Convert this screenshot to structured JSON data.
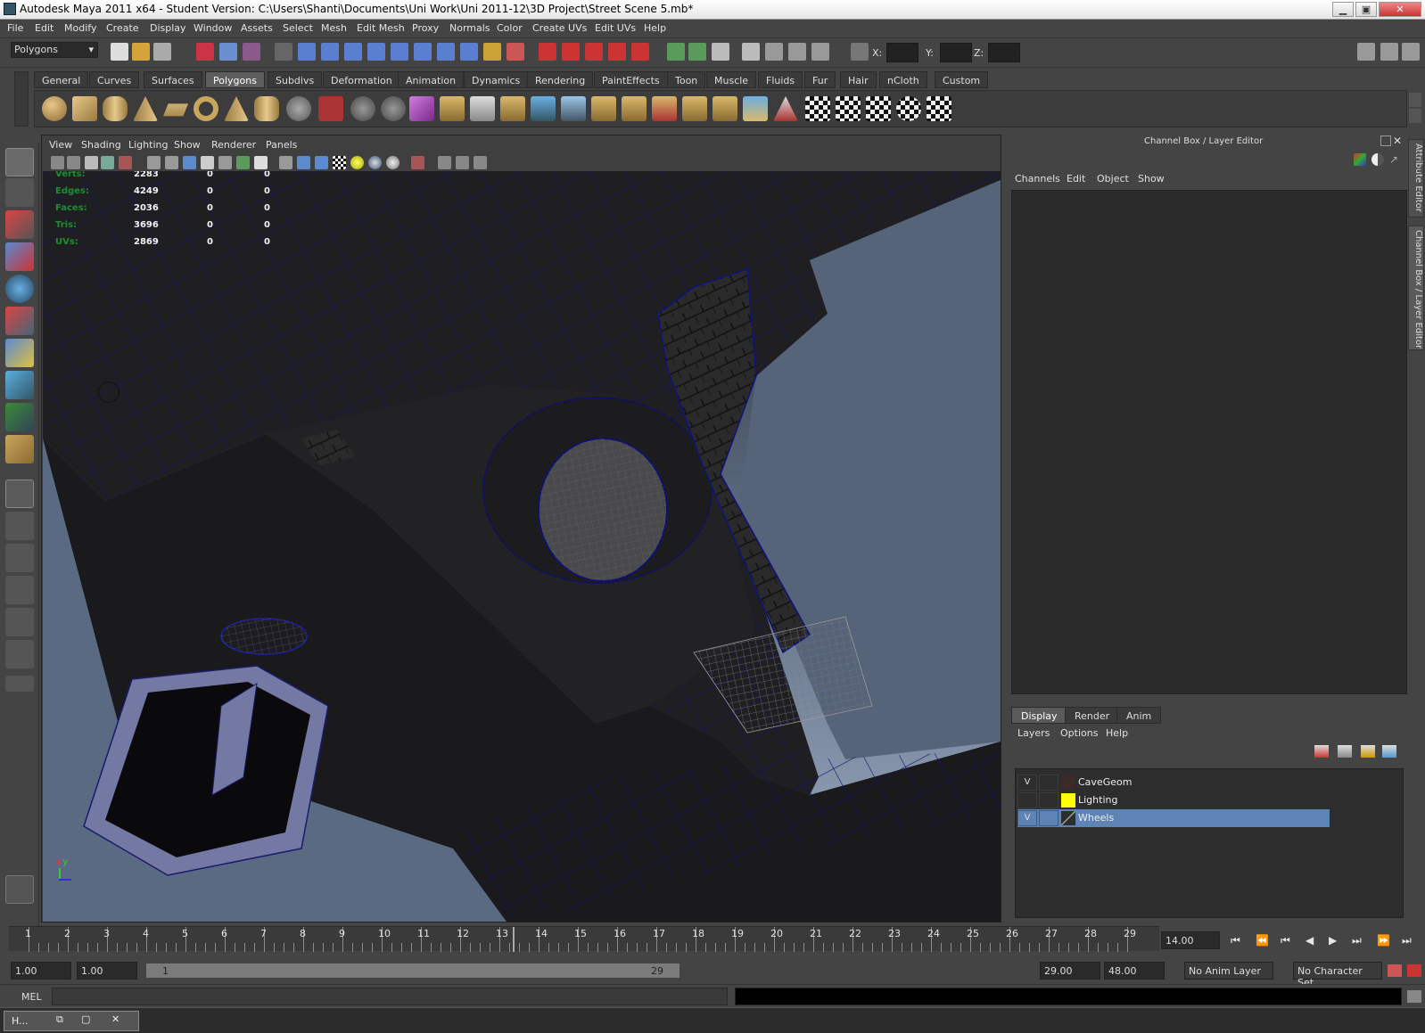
{
  "titlebar": {
    "title": "Autodesk Maya 2011 x64 - Student Version: C:\\Users\\Shanti\\Documents\\Uni Work\\Uni 2011-12\\3D Project\\Street Scene 5.mb*"
  },
  "menubar": [
    "File",
    "Edit",
    "Modify",
    "Create",
    "Display",
    "Window",
    "Assets",
    "Select",
    "Mesh",
    "Edit Mesh",
    "Proxy",
    "Normals",
    "Color",
    "Create UVs",
    "Edit UVs",
    "Help"
  ],
  "statusline": {
    "mode": "Polygons",
    "x_label": "X:",
    "y_label": "Y:",
    "z_label": "Z:"
  },
  "shelf_tabs": [
    "General",
    "Curves",
    "Surfaces",
    "Polygons",
    "Subdivs",
    "Deformation",
    "Animation",
    "Dynamics",
    "Rendering",
    "PaintEffects",
    "Toon",
    "Muscle",
    "Fluids",
    "Fur",
    "Hair",
    "nCloth",
    "Custom"
  ],
  "shelf_active": "Polygons",
  "viewport": {
    "menus": [
      "View",
      "Shading",
      "Lighting",
      "Show",
      "Renderer",
      "Panels"
    ],
    "hud": [
      {
        "label": "Verts:",
        "v1": "2283",
        "v2": "0",
        "v3": "0"
      },
      {
        "label": "Edges:",
        "v1": "4249",
        "v2": "0",
        "v3": "0"
      },
      {
        "label": "Faces:",
        "v1": "2036",
        "v2": "0",
        "v3": "0"
      },
      {
        "label": "Tris:",
        "v1": "3696",
        "v2": "0",
        "v3": "0"
      },
      {
        "label": "UVs:",
        "v1": "2869",
        "v2": "0",
        "v3": "0"
      }
    ],
    "axis_x": "x",
    "axis_y": "y"
  },
  "channel_box": {
    "title": "Channel Box / Layer Editor",
    "menus": [
      "Channels",
      "Edit",
      "Object",
      "Show"
    ]
  },
  "layer_editor": {
    "tabs": [
      "Display",
      "Render",
      "Anim"
    ],
    "active_tab": "Display",
    "menus": [
      "Layers",
      "Options",
      "Help"
    ],
    "layers": [
      {
        "visible": "V",
        "name": "CaveGeom",
        "color": "#3a2a2a",
        "selected": false
      },
      {
        "visible": "",
        "name": "Lighting",
        "color": "#ffff00",
        "selected": false
      },
      {
        "visible": "V",
        "name": "Wheels",
        "color": "#2d2d2d",
        "selected": true
      }
    ]
  },
  "side_tabs": [
    "Attribute Editor",
    "Channel Box / Layer Editor"
  ],
  "timeline": {
    "frames": [
      "1",
      "2",
      "3",
      "4",
      "5",
      "6",
      "7",
      "8",
      "9",
      "10",
      "11",
      "12",
      "13",
      "14",
      "15",
      "16",
      "17",
      "18",
      "19",
      "20",
      "21",
      "22",
      "23",
      "24",
      "25",
      "26",
      "27",
      "28",
      "29"
    ],
    "current_time": "14.00"
  },
  "range": {
    "start": "1.00",
    "playback_start": "1.00",
    "range_min": "1",
    "range_max": "29",
    "playback_end": "29.00",
    "end": "48.00",
    "anim_layer": "No Anim Layer",
    "char_set": "No Character Set"
  },
  "cmdline": {
    "label": "MEL"
  },
  "taskbar": {
    "item": "H..."
  },
  "colors": {
    "accent": "#5d84b5",
    "bg": "#444444",
    "hud_label": "#1b8e2e"
  }
}
